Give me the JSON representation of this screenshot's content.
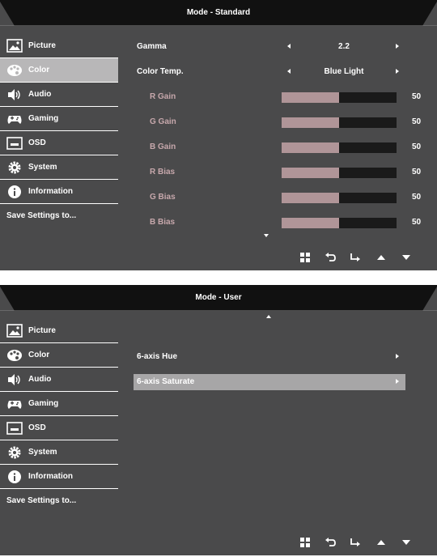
{
  "sidebar_items": [
    {
      "label": "Picture",
      "icon": "picture-icon"
    },
    {
      "label": "Color",
      "icon": "palette-icon"
    },
    {
      "label": "Audio",
      "icon": "speaker-icon"
    },
    {
      "label": "Gaming",
      "icon": "gamepad-icon"
    },
    {
      "label": "OSD",
      "icon": "osd-screen-icon"
    },
    {
      "label": "System",
      "icon": "gear-icon"
    },
    {
      "label": "Information",
      "icon": "info-icon"
    },
    {
      "label": "Save Settings to..."
    }
  ],
  "screen1": {
    "title": "Mode - Standard",
    "active_item": "Color",
    "gamma": {
      "label": "Gamma",
      "value": "2.2"
    },
    "color_temp": {
      "label": "Color Temp.",
      "value": "Blue Light"
    },
    "sliders": [
      {
        "label": "R Gain",
        "value": 50
      },
      {
        "label": "G Gain",
        "value": 50
      },
      {
        "label": "B Gain",
        "value": 50
      },
      {
        "label": "R Bias",
        "value": 50
      },
      {
        "label": "G Bias",
        "value": 50
      },
      {
        "label": "B Bias",
        "value": 50
      }
    ],
    "slider_max": 100
  },
  "screen2": {
    "title": "Mode - User",
    "hue": {
      "label": "6-axis Hue"
    },
    "saturate": {
      "label": "6-axis Saturate"
    }
  },
  "navbar_icons": [
    "menu-grid-icon",
    "return-icon",
    "enter-icon",
    "up-icon",
    "down-icon"
  ],
  "colors": {
    "panel": "#4a4a4b",
    "active": "#b8b7b8",
    "slider_fill": "#b09598",
    "slider_track": "#1a1a1a",
    "sub_label": "#c7a8ac"
  }
}
